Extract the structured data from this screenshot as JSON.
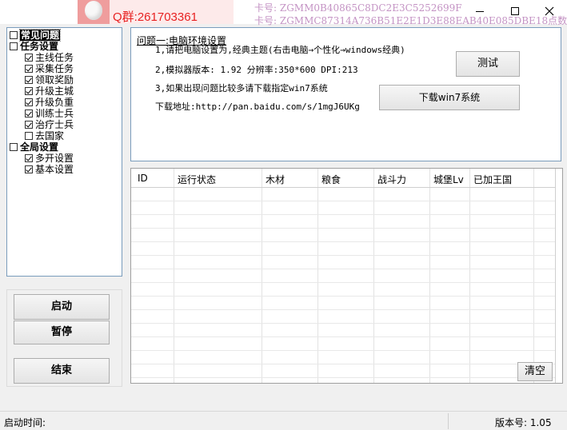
{
  "titlebar": {
    "qq_group": "Q群:261703361",
    "card_line_1": "卡号: ZGMM0B40865C8DC2E3C5252699F",
    "card_line_2": "卡号: ZGMMC87314A736B51E2E1D3E88EAB40E085DBE18点数"
  },
  "tree": {
    "items": [
      {
        "label": "常见问题",
        "checked": false,
        "level": 0,
        "bold": true,
        "selected": true
      },
      {
        "label": "任务设置",
        "checked": false,
        "level": 0,
        "bold": true
      },
      {
        "label": "主线任务",
        "checked": true,
        "level": 1
      },
      {
        "label": "采集任务",
        "checked": true,
        "level": 1
      },
      {
        "label": "领取奖励",
        "checked": true,
        "level": 1
      },
      {
        "label": "升级主城",
        "checked": true,
        "level": 1
      },
      {
        "label": "升级负重",
        "checked": true,
        "level": 1
      },
      {
        "label": "训练士兵",
        "checked": true,
        "level": 1
      },
      {
        "label": "治疗士兵",
        "checked": true,
        "level": 1
      },
      {
        "label": "去国家",
        "checked": false,
        "level": 1
      },
      {
        "label": "全局设置",
        "checked": false,
        "level": 0,
        "bold": true
      },
      {
        "label": "多开设置",
        "checked": true,
        "level": 1
      },
      {
        "label": "基本设置",
        "checked": true,
        "level": 1
      }
    ]
  },
  "buttons": {
    "start": "启动",
    "pause": "暂停",
    "end": "结束",
    "test": "测试",
    "download_win7": "下载win7系统",
    "clear": "清空"
  },
  "info": {
    "title": "问题一:电脑环境设置",
    "line1": "1,请把电脑设置为,经典主题(右击电脑→个性化→windows经典)",
    "line2": "2,模拟器版本: 1.92 分辨率:350*600 DPI:213",
    "line3": "3,如果出现问题比较多请下载指定win7系统",
    "download_label": "下载地址:http://pan.baidu.com/s/1mgJ6UKg"
  },
  "table": {
    "columns": [
      "ID",
      "运行状态",
      "木材",
      "粮食",
      "战斗力",
      "城堡Lv",
      "已加王国"
    ],
    "rows": []
  },
  "status": {
    "start_time_label": "启动时间:",
    "version_label": "版本号: 1.05"
  }
}
